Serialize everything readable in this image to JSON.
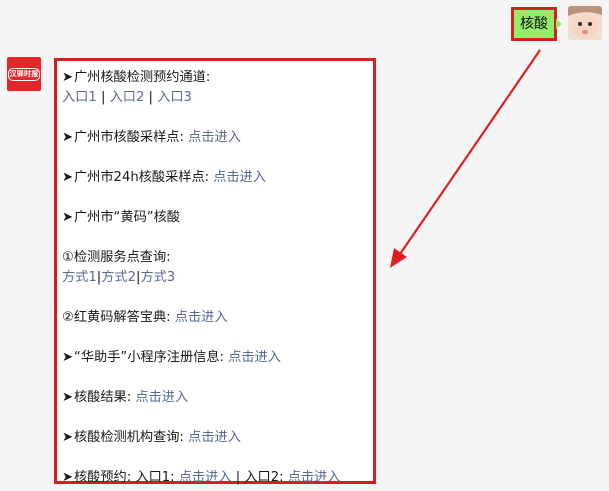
{
  "user_message": "核酸",
  "bot_avatar_text": "汉驿时报",
  "colors": {
    "bubble_user": "#95ec69",
    "highlight": "#d21f1f",
    "link": "#576b95"
  },
  "bot_message": {
    "line1": {
      "arrow": "➤",
      "text": "广州核酸检测预约通道:"
    },
    "line2": {
      "link1": "入口1",
      "sep1": " | ",
      "link2": "入口2",
      "sep2": " | ",
      "link3": "入口3"
    },
    "line3": {
      "arrow": "➤",
      "text": "广州市核酸采样点: ",
      "link": "点击进入"
    },
    "line4": {
      "arrow": "➤",
      "text": "广州市24h核酸采样点: ",
      "link": "点击进入"
    },
    "line5": {
      "arrow": "➤",
      "text": "广州市“黄码”核酸"
    },
    "line6": {
      "text": "①检测服务点查询:"
    },
    "line7": {
      "link1": "方式1",
      "sep1": "|",
      "link2": "方式2",
      "sep2": "|",
      "link3": "方式3"
    },
    "line8": {
      "text": "②红黄码解答宝典: ",
      "link": "点击进入"
    },
    "line9": {
      "arrow": "➤",
      "text": "“华助手”小程序注册信息: ",
      "link": "点击进入"
    },
    "line10": {
      "arrow": "➤",
      "text": "核酸结果: ",
      "link": "点击进入"
    },
    "line11": {
      "arrow": "➤",
      "text": "核酸检测机构查询: ",
      "link": "点击进入"
    },
    "line12": {
      "arrow": "➤",
      "text": "核酸预约: 入口1: ",
      "link1": "点击进入",
      "sep": " | 入口2: ",
      "link2": "点击进入"
    }
  }
}
